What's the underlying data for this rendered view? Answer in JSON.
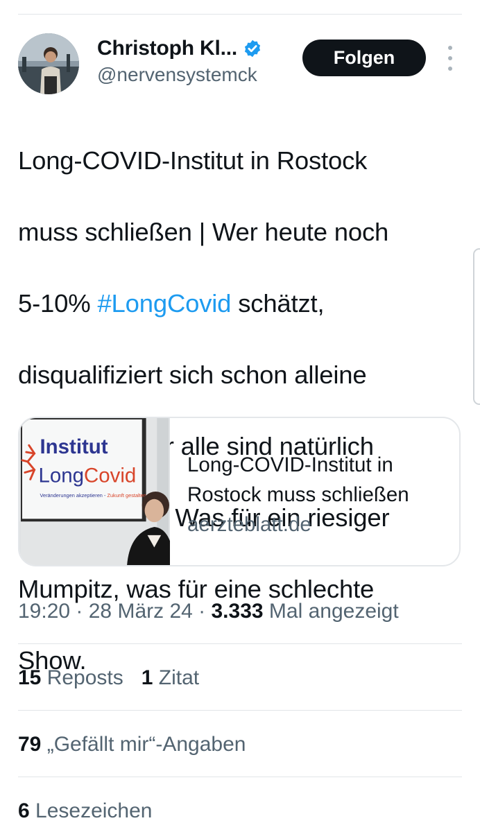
{
  "author": {
    "display_name": "Christoph Kl...",
    "handle": "@nervensystemck",
    "verified": true,
    "verified_color": "#1d9bf0"
  },
  "actions": {
    "follow_label": "Folgen",
    "more_icon": "more-vertical-icon"
  },
  "tweet": {
    "lines": [
      "Long-COVID-Institut in Rostock",
      "muss schließen | Wer heute noch",
      "5-10% ",
      "disqualifiziert sich schon alleine",
      "dadurch. Aber alle sind natürlich",
      "„renommiert“. Was für ein riesiger",
      "Mumpitz, was für eine schlechte",
      "Show."
    ],
    "hashtag": "#LongCovid",
    "after_hashtag": " schätzt,",
    "hashtag_color": "#1d9bf0"
  },
  "link_card": {
    "title": "Long-COVID-Institut in Rostock muss schließen",
    "domain": "aerzteblatt.de",
    "image": {
      "sign_line1": "Institut",
      "sign_line2_a": "Long",
      "sign_line2_b": "Covid",
      "sign_tagline_a": "Veränderungen akzeptieren - ",
      "sign_tagline_b": "Zukunft gestalten"
    }
  },
  "meta": {
    "time": "19:20",
    "separator": " · ",
    "date": "28 März 24",
    "views_count": "3.333",
    "views_label": " Mal angezeigt"
  },
  "stats": {
    "reposts_count": "15",
    "reposts_label": " Reposts",
    "quotes_count": "1",
    "quotes_label": " Zitat",
    "likes_count": "79",
    "likes_label": " „Gefällt mir“-Angaben",
    "bookmarks_count": "6",
    "bookmarks_label": " Lesezeichen"
  }
}
